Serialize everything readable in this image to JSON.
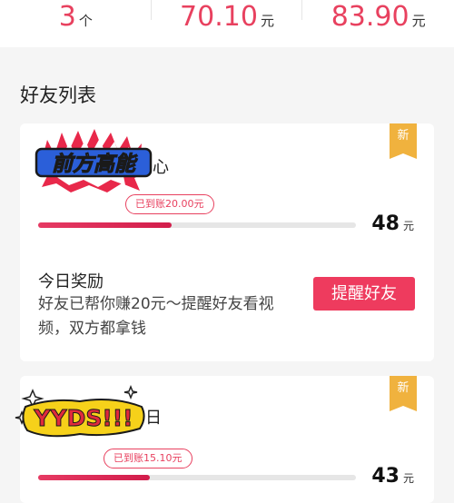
{
  "stats": [
    {
      "value": "3",
      "unit": "个"
    },
    {
      "value": "70.10",
      "unit": "元"
    },
    {
      "value": "83.90",
      "unit": "元"
    }
  ],
  "section_title": "好友列表",
  "friends": [
    {
      "sticker_text": "前方高能",
      "name_tail": "心",
      "badge": "新",
      "credited": "已到账20.00元",
      "progress": 0.42,
      "amount": "48",
      "amount_unit": "元",
      "reward_title": "今日奖励",
      "reward_desc": "好友已帮你赚20元～提醒好友看视频，双方都拿钱",
      "remind_button": "提醒好友"
    },
    {
      "sticker_text": "YYDS!!!",
      "name_tail": "日",
      "badge": "新",
      "credited": "已到账15.10元",
      "progress": 0.35,
      "amount": "43",
      "amount_unit": "元"
    }
  ],
  "colors": {
    "accent": "#e8415f",
    "badge": "#f0b23e",
    "button": "#ee3b5e"
  }
}
